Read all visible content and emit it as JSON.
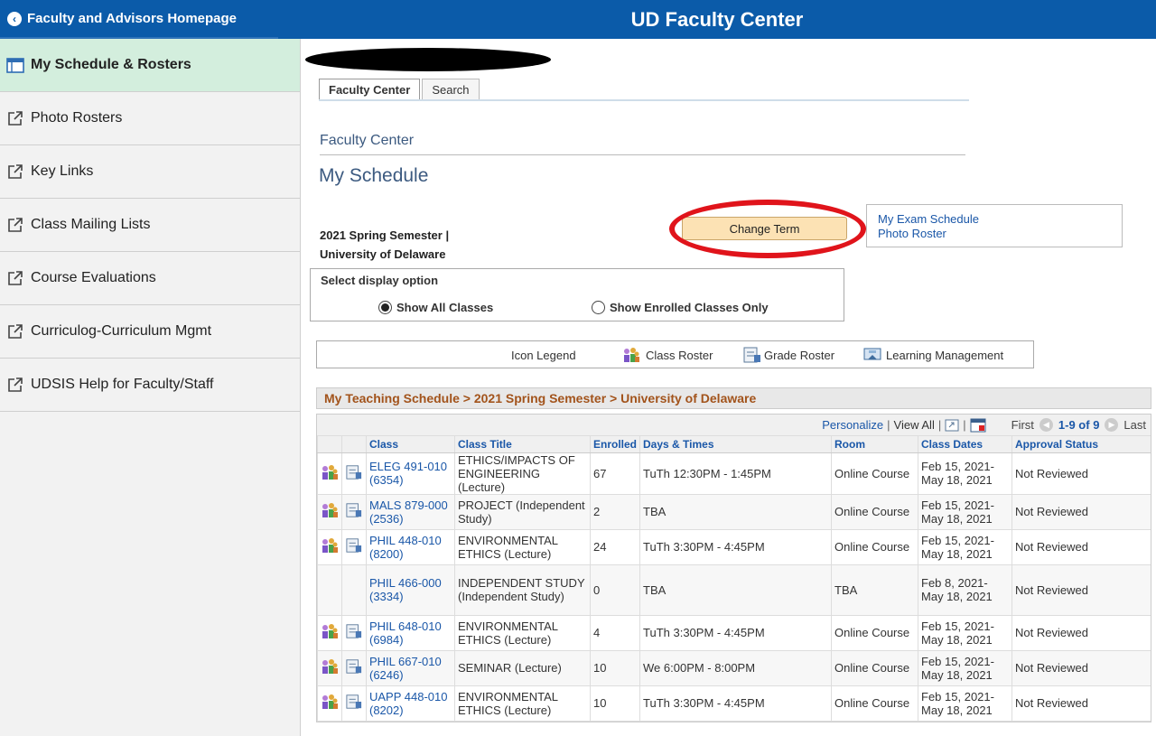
{
  "header": {
    "back_label": "Faculty and Advisors Homepage",
    "title": "UD Faculty Center"
  },
  "sidebar": {
    "items": [
      {
        "label": "My Schedule & Rosters",
        "icon": "grid-icon"
      },
      {
        "label": "Photo Rosters",
        "icon": "external-link-icon"
      },
      {
        "label": "Key Links",
        "icon": "external-link-icon"
      },
      {
        "label": "Class Mailing Lists",
        "icon": "external-link-icon"
      },
      {
        "label": "Course Evaluations",
        "icon": "external-link-icon"
      },
      {
        "label": "Curriculog-Curriculum Mgmt",
        "icon": "external-link-icon"
      },
      {
        "label": "UDSIS Help for Faculty/Staff",
        "icon": "external-link-icon"
      }
    ]
  },
  "tabs": [
    "Faculty Center",
    "Search"
  ],
  "breadcrumb": "Faculty Center",
  "page_title": "My Schedule",
  "term": {
    "line1": "2021 Spring Semester |",
    "line2": "University of Delaware",
    "change_label": "Change Term"
  },
  "links": {
    "exam": "My Exam Schedule",
    "photo": "Photo Roster"
  },
  "display_option": {
    "title": "Select display option",
    "all": "Show All Classes",
    "enrolled": "Show Enrolled Classes Only"
  },
  "icon_legend": {
    "title": "Icon Legend",
    "class_roster": "Class Roster",
    "grade_roster": "Grade Roster",
    "lms": "Learning Management"
  },
  "schedule": {
    "title": "My Teaching Schedule > 2021 Spring Semester > University of Delaware",
    "nav": {
      "personalize": "Personalize",
      "view_all": "View All",
      "first": "First",
      "range": "1-9 of 9",
      "last": "Last"
    },
    "columns": [
      "Class",
      "Class Title",
      "Enrolled",
      "Days & Times",
      "Room",
      "Class Dates",
      "Approval Status"
    ],
    "rows": [
      {
        "class": "ELEG 491-010",
        "num": "(6354)",
        "title": "ETHICS/IMPACTS OF ENGINEERING (Lecture)",
        "enrolled": "67",
        "days": "TuTh 12:30PM - 1:45PM",
        "room": "Online Course",
        "dates": "Feb 15, 2021- May 18, 2021",
        "status": "Not Reviewed"
      },
      {
        "class": "MALS 879-000",
        "num": "(2536)",
        "title": "PROJECT (Independent Study)",
        "enrolled": "2",
        "days": "TBA",
        "room": "Online Course",
        "dates": "Feb 15, 2021- May 18, 2021",
        "status": "Not Reviewed"
      },
      {
        "class": "PHIL 448-010",
        "num": "(8200)",
        "title": "ENVIRONMENTAL ETHICS (Lecture)",
        "enrolled": "24",
        "days": "TuTh 3:30PM - 4:45PM",
        "room": "Online Course",
        "dates": "Feb 15, 2021- May 18, 2021",
        "status": "Not Reviewed"
      },
      {
        "class": "PHIL 466-000",
        "num": "(3334)",
        "title": "INDEPENDENT STUDY (Independent Study)",
        "enrolled": "0",
        "days": "TBA",
        "room": "TBA",
        "dates": "Feb 8, 2021- May 18, 2021",
        "status": "Not Reviewed"
      },
      {
        "class": "PHIL 648-010",
        "num": "(6984)",
        "title": "ENVIRONMENTAL ETHICS (Lecture)",
        "enrolled": "4",
        "days": "TuTh 3:30PM - 4:45PM",
        "room": "Online Course",
        "dates": "Feb 15, 2021- May 18, 2021",
        "status": "Not Reviewed"
      },
      {
        "class": "PHIL 667-010",
        "num": "(6246)",
        "title": "SEMINAR (Lecture)",
        "enrolled": "10",
        "days": "We 6:00PM - 8:00PM",
        "room": "Online Course",
        "dates": "Feb 15, 2021- May 18, 2021",
        "status": "Not Reviewed"
      },
      {
        "class": "UAPP 448-010",
        "num": "(8202)",
        "title": "ENVIRONMENTAL ETHICS (Lecture)",
        "enrolled": "10",
        "days": "TuTh 3:30PM - 4:45PM",
        "room": "Online Course",
        "dates": "Feb 15, 2021- May 18, 2021",
        "status": "Not Reviewed"
      }
    ]
  }
}
